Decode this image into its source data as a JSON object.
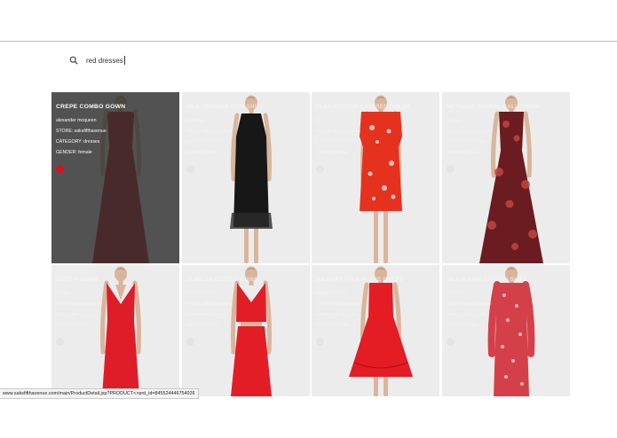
{
  "search": {
    "query": "red dresses",
    "icon": "search-icon"
  },
  "products": [
    {
      "name": "CREPE COMBO GOWN",
      "brand": "alexander mcqueen",
      "store": "STORE: saksfifthavenue",
      "category": "CATEGORY: dresses",
      "gender": "GENDER: female",
      "dress_color": "#b71522",
      "style": "gown"
    },
    {
      "name": "SILK-TRIMMED KNIT SHIFT",
      "brand": "Elie Tahari",
      "store": "STORE: saksfifthavenue",
      "category": "CATEGORY: dresses",
      "gender": "GENDER: female",
      "dress_color": "#171717",
      "style": "shift"
    },
    {
      "name": "ELSY PRINTED LAYERED DRESS",
      "brand": "Elie",
      "store": "STORE: saksfifthavenue",
      "category": "CATEGORY: dresses",
      "gender": "GENDER: female",
      "dress_color": "#e5321e",
      "style": "print"
    },
    {
      "name": "METALLIC FLORAL BALL GOWN",
      "brand": "Teri Jon",
      "store": "STORE: saksfifthavenue",
      "category": "CATEGORY: dresses",
      "gender": "GENDER: female",
      "dress_color": "#6b1c20",
      "style": "ballgown"
    },
    {
      "name": "DEEP V GOWN",
      "brand": "Halston",
      "store": "STORE: saksfifthavenue",
      "category": "CATEGORY: dresses",
      "gender": "GENDER: female",
      "dress_color": "#df1d29",
      "style": "vgown"
    },
    {
      "name": "CUBELIA CUTOUT GOWN",
      "brand": "Halston Heritage",
      "store": "STORE: saksfifthavenue",
      "category": "CATEGORY: dresses",
      "gender": "GENDER: female",
      "dress_color": "#e21d26",
      "style": "twopiece"
    },
    {
      "name": "MILITARY FIT-&-FLARE DRESS",
      "brand": "Badgley Mischka",
      "store": "STORE: saksfifthavenue",
      "category": "CATEGORY: dresses",
      "gender": "GENDER: female",
      "dress_color": "#e41c24",
      "style": "flare"
    },
    {
      "name": "SILK & AMPI COTTON SHIFT",
      "brand": "Tory Burch",
      "store": "STORE: saksfifthavenue",
      "category": "CATEGORY: dresses",
      "gender": "GENDER: female",
      "dress_color": "#d4404a",
      "style": "longsleeve"
    }
  ],
  "status_bar": {
    "url": "www.saksfifthavenue.com/main/ProductDetail.jsp?PRODUCT<>prd_id=845524446754026"
  },
  "colors": {
    "active_dot": "#d8121b",
    "card_bg": "#ececec",
    "overlay": "#303030"
  }
}
